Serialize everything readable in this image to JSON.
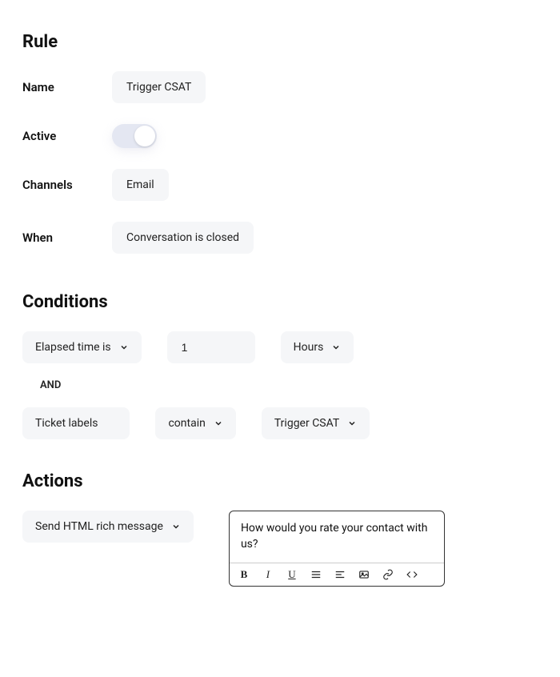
{
  "rule": {
    "title": "Rule",
    "name_label": "Name",
    "name_value": "Trigger CSAT",
    "active_label": "Active",
    "active_on": true,
    "channels_label": "Channels",
    "channels_value": "Email",
    "when_label": "When",
    "when_value": "Conversation is closed"
  },
  "conditions": {
    "title": "Conditions",
    "row1": {
      "field": "Elapsed time is",
      "value": "1",
      "unit": "Hours"
    },
    "and_label": "AND",
    "row2": {
      "field": "Ticket labels",
      "operator": "contain",
      "value": "Trigger CSAT"
    }
  },
  "actions": {
    "title": "Actions",
    "action_type": "Send HTML rich message",
    "message": "How would you rate your contact with us?",
    "toolbar": {
      "bold": "B",
      "italic": "I",
      "underline": "U"
    }
  }
}
